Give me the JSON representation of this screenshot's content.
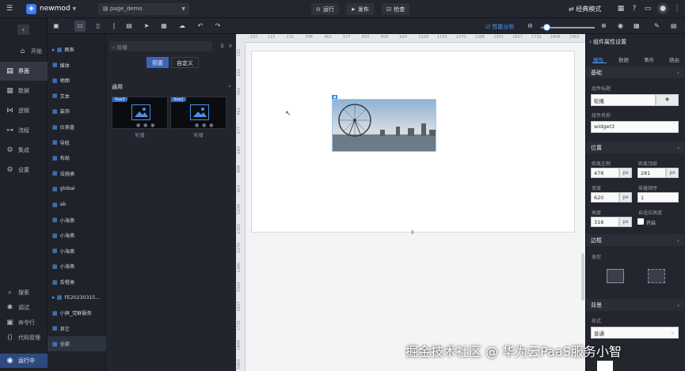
{
  "app": {
    "name": "newmod",
    "page": "page_demo"
  },
  "topbar": {
    "run": "运行",
    "publish": "发布",
    "check": "检查",
    "mode": "经典模式"
  },
  "nav": [
    {
      "icon": "home-icon",
      "label": "开始"
    },
    {
      "icon": "page-icon",
      "label": "界面"
    },
    {
      "icon": "data-icon",
      "label": "数据"
    },
    {
      "icon": "logic-icon",
      "label": "逻辑"
    },
    {
      "icon": "flow-icon",
      "label": "流程"
    },
    {
      "icon": "integration-icon",
      "label": "集成"
    },
    {
      "icon": "settings-icon",
      "label": "设置"
    }
  ],
  "nav_bottom": [
    {
      "icon": "search-icon",
      "label": "搜索"
    },
    {
      "icon": "debug-icon",
      "label": "调试"
    },
    {
      "icon": "terminal-icon",
      "label": "命令行"
    },
    {
      "icon": "code-icon",
      "label": "代码管理"
    },
    {
      "icon": "running-icon",
      "label": "运行中"
    }
  ],
  "tree": [
    "图表",
    "媒体",
    "地图",
    "文本",
    "装饰",
    "仪表盘",
    "导航",
    "布局",
    "设施类",
    "global",
    "ab",
    "小海燕",
    "小海燕",
    "小海燕",
    "小海燕",
    "舌橙类",
    "FE20230315...",
    "小屏_党群服务",
    "其它",
    "全部"
  ],
  "components": {
    "search_placeholder": "轮播",
    "tab_preview": "预置",
    "tab_custom": "自定义",
    "section": "通用",
    "cards": [
      {
        "tag": "Vue3",
        "label": "轮播"
      },
      {
        "tag": "Vue2",
        "label": "轮播"
      }
    ]
  },
  "canvas": {
    "perf": "性能分析",
    "ruler_h": [
      "-102",
      "115",
      "231",
      "346",
      "462",
      "577",
      "693",
      "808",
      "924",
      "1039",
      "1155",
      "1270",
      "1386",
      "1501",
      "1617",
      "1732",
      "1848",
      "1963"
    ],
    "ruler_v": [
      "115",
      "231",
      "346",
      "462",
      "577",
      "693",
      "808",
      "924",
      "1039",
      "1155",
      "1270",
      "1386",
      "1501",
      "1617",
      "1732",
      "1848",
      "1963"
    ]
  },
  "props": {
    "title": "组件属性设置",
    "tabs": [
      "属性",
      "数据",
      "事件",
      "路由"
    ],
    "basic": "基础",
    "comp_title_label": "组件标题",
    "comp_title": "轮播",
    "comp_name_label": "组件名称",
    "comp_name": "widget3",
    "position": "位置",
    "left_label": "距离左侧",
    "left": "478",
    "top_label": "距离顶部",
    "top": "281",
    "width_label": "宽度",
    "width": "620",
    "stack_label": "堆叠顺序",
    "stack": "1",
    "height_label": "高度",
    "height": "318",
    "adapt_label": "自适应高度",
    "adapt_toggle": "开启",
    "unit": "px",
    "border": "边框",
    "type_label": "类型",
    "background": "背景",
    "style_label": "样式",
    "style_value": "普通"
  },
  "watermark": "掘金技术社区 @ 华为云PaaS服务小智"
}
